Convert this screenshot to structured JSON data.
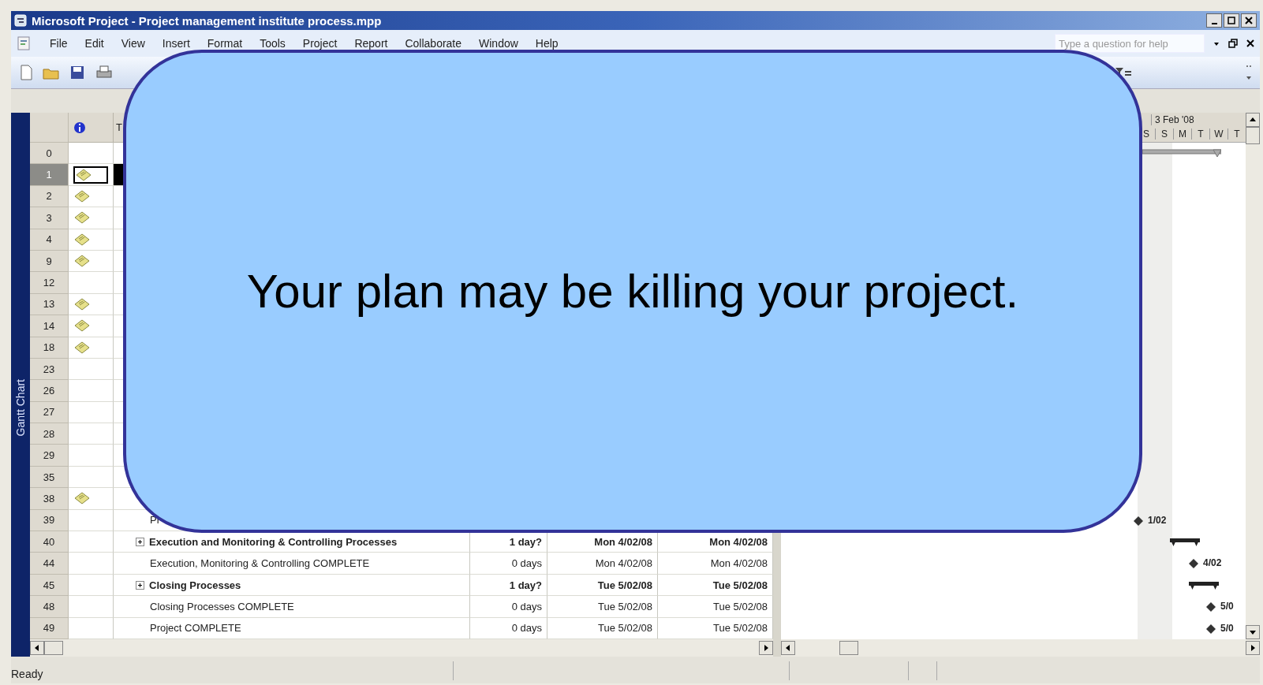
{
  "window": {
    "title": "Microsoft Project - Project management institute process.mpp"
  },
  "menu": [
    "File",
    "Edit",
    "View",
    "Insert",
    "Format",
    "Tools",
    "Project",
    "Report",
    "Collaborate",
    "Window",
    "Help"
  ],
  "help_field": {
    "placeholder": "Type a question for help"
  },
  "view_bar": {
    "label": "Gantt Chart"
  },
  "table": {
    "task_header": "T",
    "rows": [
      {
        "number": "0",
        "note": false,
        "selected": false,
        "bar": {
          "kind": "project"
        }
      },
      {
        "number": "1",
        "note": true,
        "selected": true
      },
      {
        "number": "2",
        "note": true,
        "selected": false
      },
      {
        "number": "3",
        "note": true,
        "selected": false
      },
      {
        "number": "4",
        "note": true,
        "selected": false
      },
      {
        "number": "9",
        "note": true,
        "selected": false
      },
      {
        "number": "12",
        "note": false,
        "selected": false
      },
      {
        "number": "13",
        "note": true,
        "selected": false
      },
      {
        "number": "14",
        "note": true,
        "selected": false
      },
      {
        "number": "18",
        "note": true,
        "selected": false
      },
      {
        "number": "23",
        "note": false,
        "selected": false
      },
      {
        "number": "26",
        "note": false,
        "selected": false
      },
      {
        "number": "27",
        "note": false,
        "selected": false
      },
      {
        "number": "28",
        "note": false,
        "selected": false
      },
      {
        "number": "29",
        "note": false,
        "selected": false
      },
      {
        "number": "35",
        "note": false,
        "selected": false
      },
      {
        "number": "38",
        "note": true,
        "selected": false
      },
      {
        "number": "39",
        "note": false,
        "selected": false,
        "name": "Pl",
        "summary": false,
        "bar": {
          "kind": "milestone",
          "label": "1/02"
        }
      },
      {
        "number": "40",
        "note": false,
        "selected": false,
        "name": "Execution and Monitoring & Controlling Processes",
        "summary": true,
        "duration": "1 day?",
        "start": "Mon 4/02/08",
        "finish": "Mon 4/02/08",
        "bar": {
          "kind": "summary"
        }
      },
      {
        "number": "44",
        "note": false,
        "selected": false,
        "name": "Execution, Monitoring & Controlling COMPLETE",
        "summary": false,
        "duration": "0 days",
        "start": "Mon 4/02/08",
        "finish": "Mon 4/02/08",
        "bar": {
          "kind": "milestone",
          "label": "4/02"
        }
      },
      {
        "number": "45",
        "note": false,
        "selected": false,
        "name": "Closing Processes",
        "summary": true,
        "duration": "1 day?",
        "start": "Tue 5/02/08",
        "finish": "Tue 5/02/08",
        "bar": {
          "kind": "summary"
        }
      },
      {
        "number": "48",
        "note": false,
        "selected": false,
        "name": "Closing Processes COMPLETE",
        "summary": false,
        "duration": "0 days",
        "start": "Tue 5/02/08",
        "finish": "Tue 5/02/08",
        "bar": {
          "kind": "milestone",
          "label": "5/0"
        }
      },
      {
        "number": "49",
        "note": false,
        "selected": false,
        "name": "Project COMPLETE",
        "summary": false,
        "duration": "0 days",
        "start": "Tue 5/02/08",
        "finish": "Tue 5/02/08",
        "bar": {
          "kind": "milestone",
          "label": "5/0"
        }
      }
    ]
  },
  "timescale": {
    "week": "3 Feb '08",
    "days": [
      "S",
      "S",
      "M",
      "T",
      "W",
      "T"
    ]
  },
  "status_bar": {
    "text": "Ready"
  },
  "callout": {
    "text": "Your plan may be killing your project."
  }
}
